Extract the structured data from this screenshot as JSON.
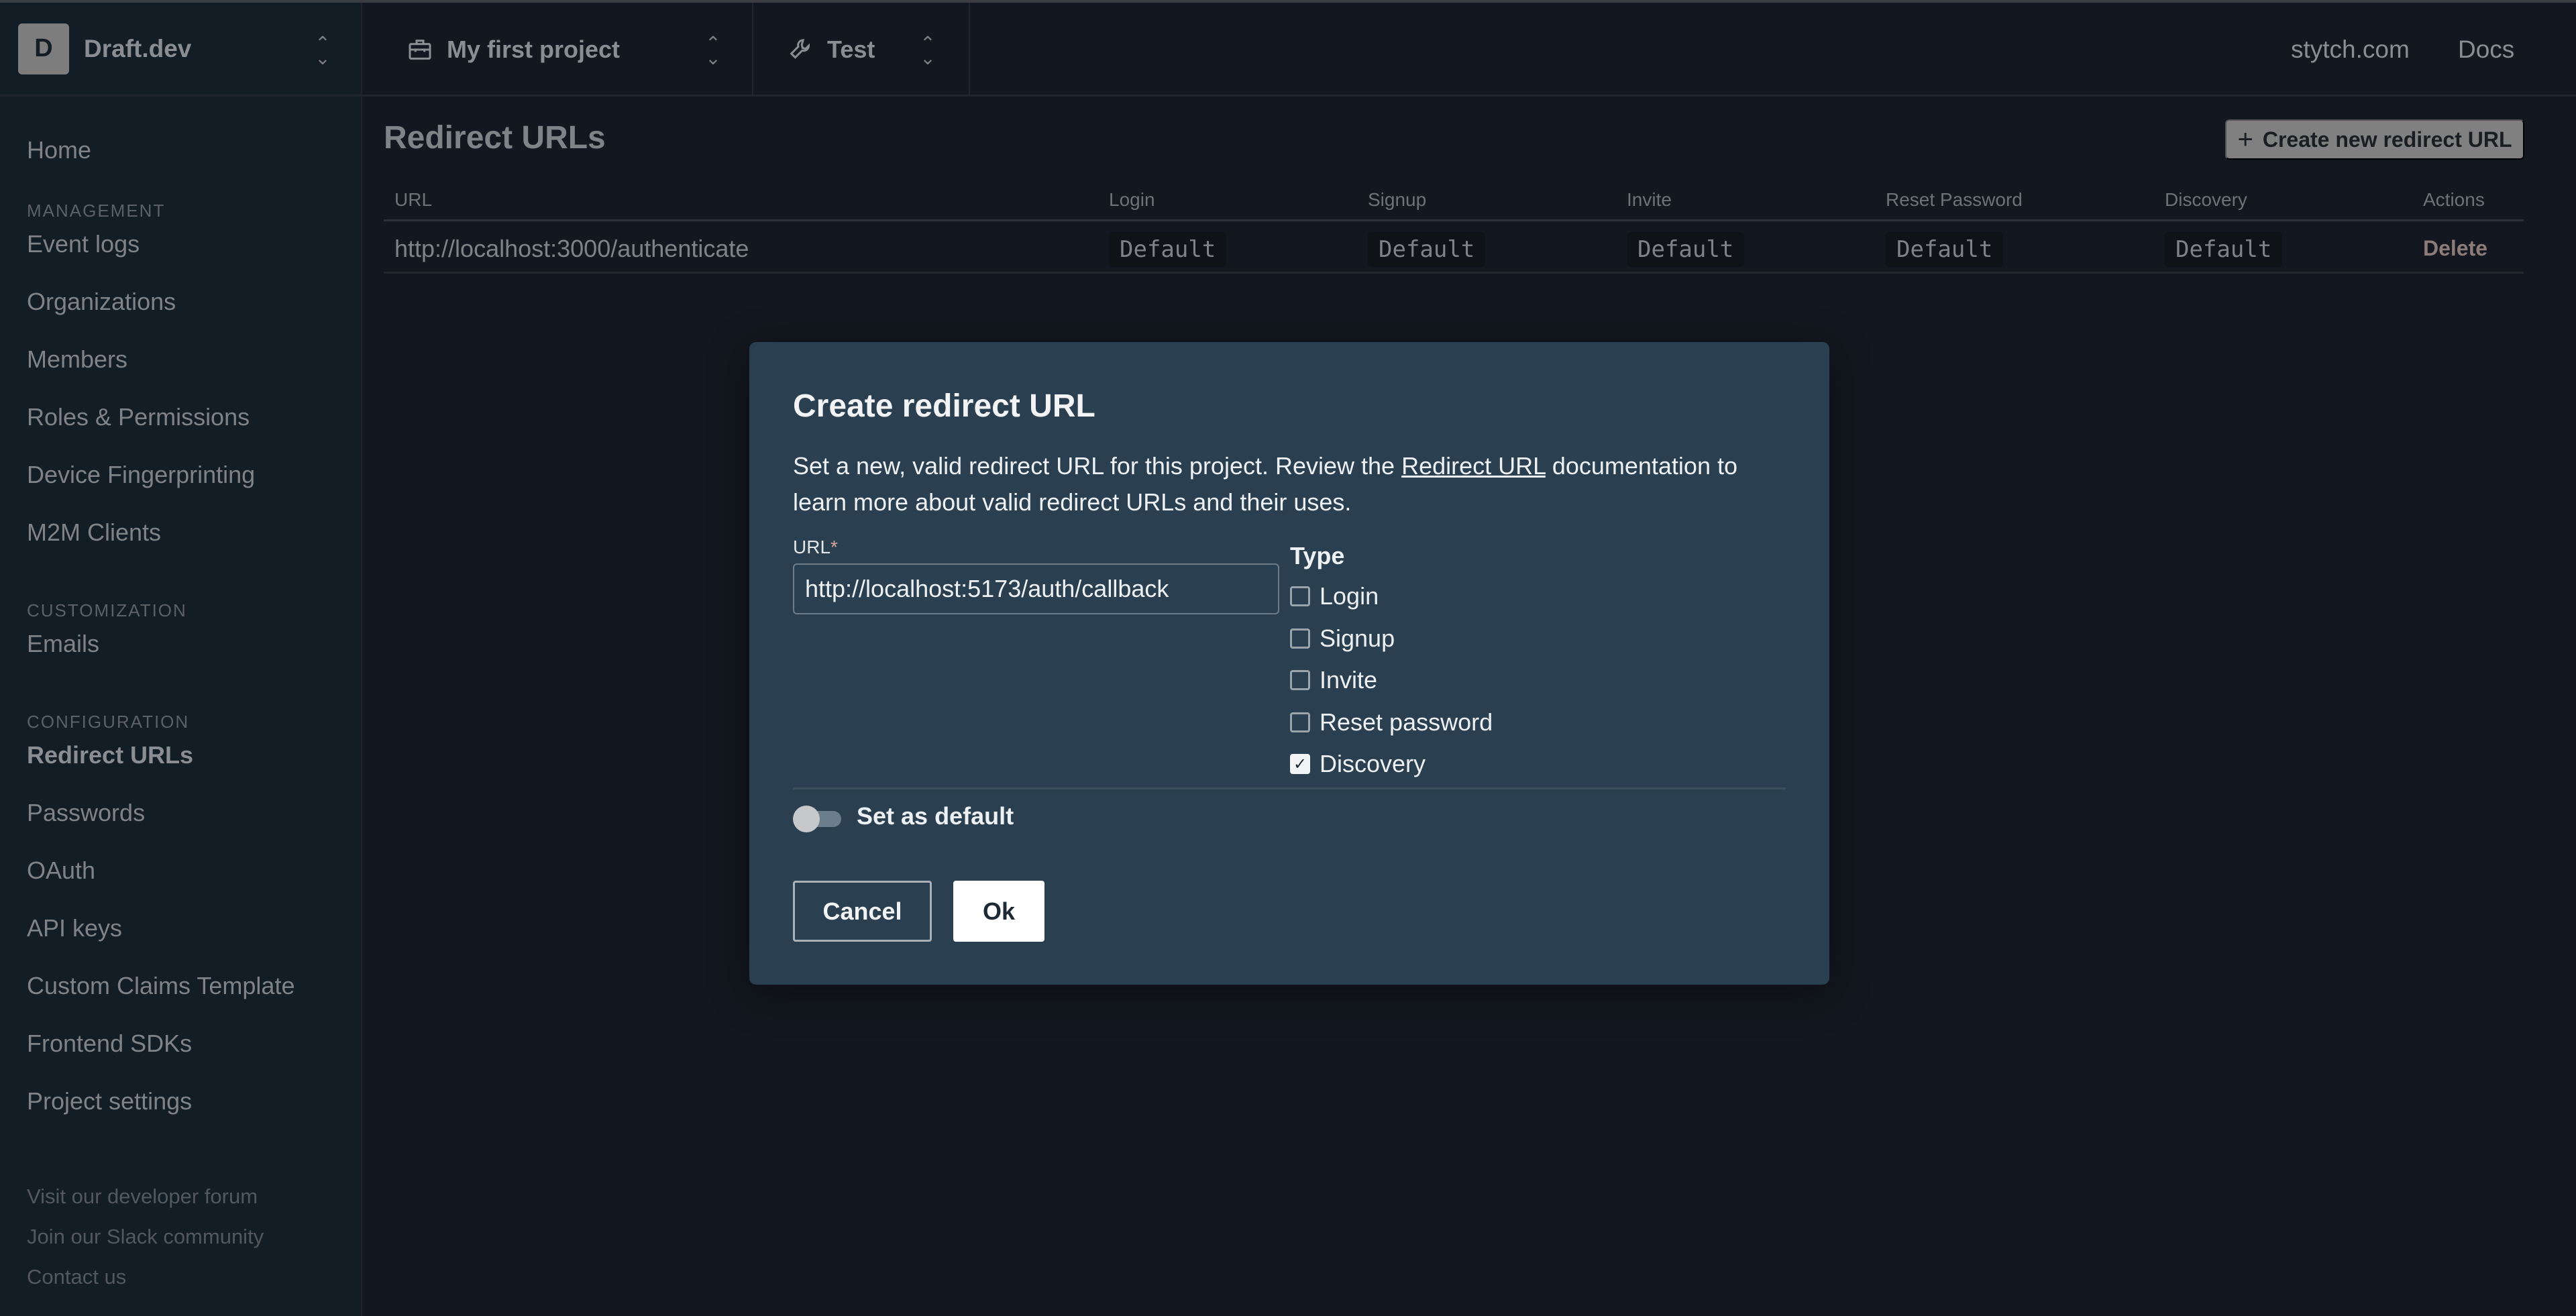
{
  "sidebar": {
    "org": {
      "initial": "D",
      "name": "Draft.dev"
    },
    "home": "Home",
    "sections": [
      {
        "title": "MANAGEMENT",
        "items": [
          "Event logs",
          "Organizations",
          "Members",
          "Roles & Permissions",
          "Device Fingerprinting",
          "M2M Clients"
        ]
      },
      {
        "title": "CUSTOMIZATION",
        "items": [
          "Emails"
        ]
      },
      {
        "title": "CONFIGURATION",
        "items": [
          "Redirect URLs",
          "Passwords",
          "OAuth",
          "API keys",
          "Custom Claims Template",
          "Frontend SDKs",
          "Project settings"
        ]
      }
    ],
    "active_item": "Redirect URLs",
    "footer_links": [
      "Visit our developer forum",
      "Join our Slack community",
      "Contact us"
    ]
  },
  "topbar": {
    "project": {
      "label": "My first project",
      "icon": "briefcase-icon"
    },
    "environment": {
      "label": "Test",
      "icon": "wrench-icon"
    },
    "links": [
      "stytch.com",
      "Docs"
    ]
  },
  "main": {
    "title": "Redirect URLs",
    "create_button": "Create new redirect URL",
    "table": {
      "columns": [
        "URL",
        "Login",
        "Signup",
        "Invite",
        "Reset Password",
        "Discovery",
        "Actions"
      ],
      "rows": [
        {
          "url": "http://localhost:3000/authenticate",
          "login": "Default",
          "signup": "Default",
          "invite": "Default",
          "reset_password": "Default",
          "discovery": "Default",
          "action": "Delete"
        }
      ]
    }
  },
  "modal": {
    "title": "Create redirect URL",
    "description_before": "Set a new, valid redirect URL for this project. Review the ",
    "description_link": "Redirect URL",
    "description_after": " documentation to learn more about valid redirect URLs and their uses.",
    "url_label": "URL",
    "url_required_mark": "*",
    "url_value": "http://localhost:5173/auth/callback",
    "type_label": "Type",
    "types": [
      {
        "label": "Login",
        "checked": false
      },
      {
        "label": "Signup",
        "checked": false
      },
      {
        "label": "Invite",
        "checked": false
      },
      {
        "label": "Reset password",
        "checked": false
      },
      {
        "label": "Discovery",
        "checked": true
      }
    ],
    "set_default_label": "Set as default",
    "set_default_on": false,
    "cancel_label": "Cancel",
    "ok_label": "Ok"
  }
}
